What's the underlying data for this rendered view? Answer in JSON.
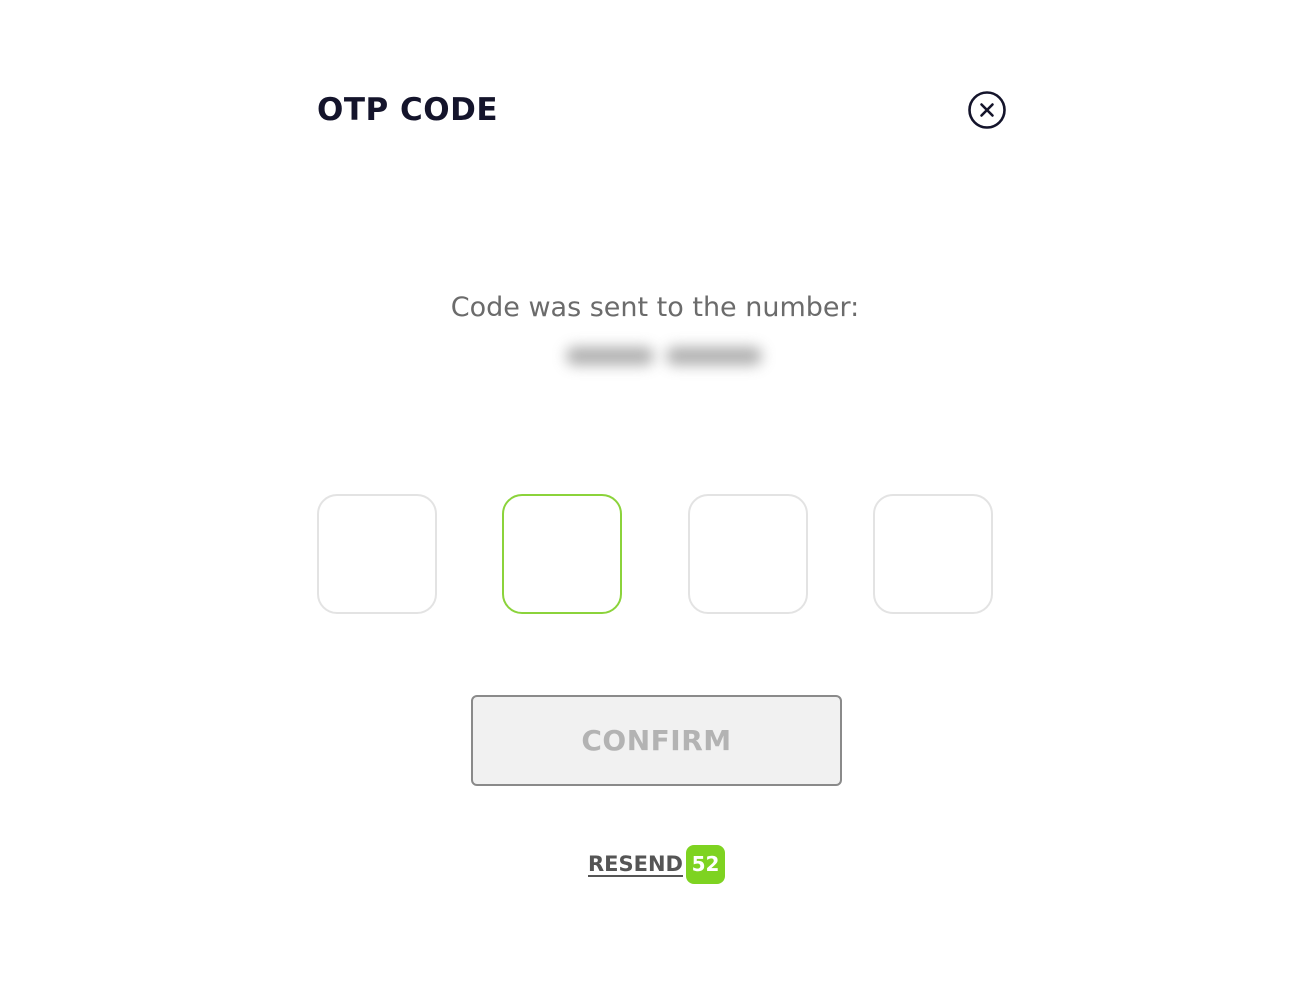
{
  "modal": {
    "title": "OTP CODE",
    "close_icon": "close-circle-x-icon"
  },
  "message": {
    "sent_text": "Code was sent to the number:",
    "phone_number_state": "blurred"
  },
  "otp": {
    "digits": [
      "",
      "",
      "",
      ""
    ],
    "active_index": 1
  },
  "actions": {
    "confirm_label": "CONFIRM",
    "confirm_enabled": false,
    "resend_label": "RESEND",
    "resend_timer": "52"
  },
  "colors": {
    "accent": "#7ed321",
    "active_border": "#8bd33b",
    "title": "#14142b",
    "disabled_text": "#b3b3b3"
  }
}
